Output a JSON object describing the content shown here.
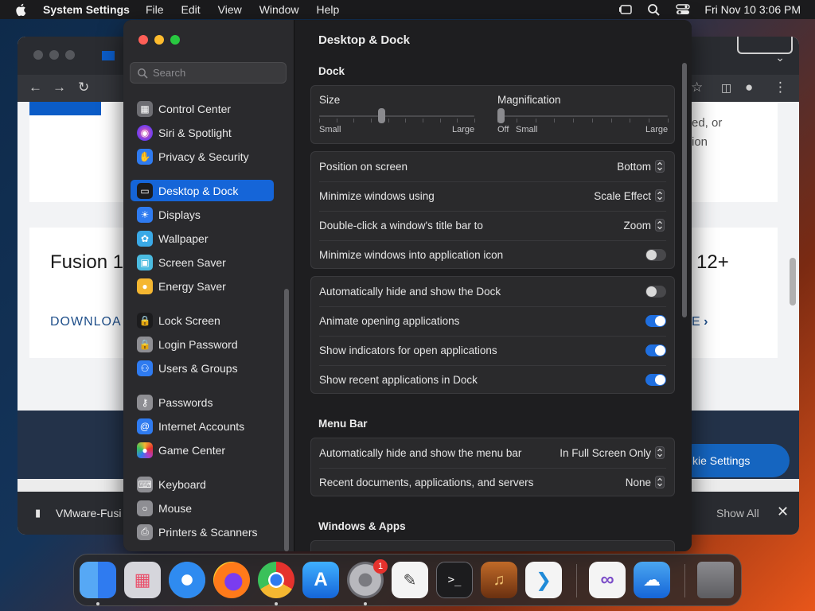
{
  "menubar": {
    "app_name": "System Settings",
    "menus": [
      "File",
      "Edit",
      "View",
      "Window",
      "Help"
    ],
    "datetime": "Fri Nov 10  3:06 PM"
  },
  "browser": {
    "partial_text_1": "ed, or",
    "partial_text_2": "ion",
    "product_left": "Fusion 1",
    "product_right": "12+",
    "download_left": "DOWNLOA",
    "download_right": "E",
    "cookie_button": "kie Settings",
    "download_file": "VMware-Fusi",
    "show_all": "Show All"
  },
  "sidebar": {
    "search_placeholder": "Search",
    "items": [
      {
        "label": "Control Center",
        "icon": "control-center-icon",
        "color": "#6e6e73"
      },
      {
        "label": "Siri & Spotlight",
        "icon": "siri-icon",
        "color": "#b03cc8"
      },
      {
        "label": "Privacy & Security",
        "icon": "privacy-hand-icon",
        "color": "#2f7bf0"
      },
      {
        "label": "Desktop & Dock",
        "icon": "desktop-dock-icon",
        "color": "#1c1c1e",
        "active": true
      },
      {
        "label": "Displays",
        "icon": "displays-icon",
        "color": "#2f7bf0"
      },
      {
        "label": "Wallpaper",
        "icon": "wallpaper-icon",
        "color": "#3aa9e6"
      },
      {
        "label": "Screen Saver",
        "icon": "screen-saver-icon",
        "color": "#4bbbe0"
      },
      {
        "label": "Energy Saver",
        "icon": "energy-saver-icon",
        "color": "#f5b731"
      },
      {
        "label": "Lock Screen",
        "icon": "lock-screen-icon",
        "color": "#1c1c1e"
      },
      {
        "label": "Login Password",
        "icon": "login-password-icon",
        "color": "#8e8e93"
      },
      {
        "label": "Users & Groups",
        "icon": "users-groups-icon",
        "color": "#2f7bf0"
      },
      {
        "label": "Passwords",
        "icon": "passwords-icon",
        "color": "#8e8e93"
      },
      {
        "label": "Internet Accounts",
        "icon": "internet-accounts-icon",
        "color": "#2f7bf0"
      },
      {
        "label": "Game Center",
        "icon": "game-center-icon",
        "color": "#ffffff"
      },
      {
        "label": "Keyboard",
        "icon": "keyboard-icon",
        "color": "#8e8e93"
      },
      {
        "label": "Mouse",
        "icon": "mouse-icon",
        "color": "#8e8e93"
      },
      {
        "label": "Printers & Scanners",
        "icon": "printers-scanners-icon",
        "color": "#8e8e93"
      }
    ]
  },
  "content": {
    "title": "Desktop & Dock",
    "dock_section": "Dock",
    "size_label": "Size",
    "size_min": "Small",
    "size_max": "Large",
    "size_value": 0.4,
    "magnification_label": "Magnification",
    "mag_off": "Off",
    "mag_min": "Small",
    "mag_max": "Large",
    "magnification_value": 0.0,
    "settings_group1": [
      {
        "label": "Position on screen",
        "value": "Bottom"
      },
      {
        "label": "Minimize windows using",
        "value": "Scale Effect"
      },
      {
        "label": "Double-click a window's title bar to",
        "value": "Zoom"
      },
      {
        "label": "Minimize windows into application icon",
        "toggle": false
      }
    ],
    "settings_group2": [
      {
        "label": "Automatically hide and show the Dock",
        "toggle": false
      },
      {
        "label": "Animate opening applications",
        "toggle": true
      },
      {
        "label": "Show indicators for open applications",
        "toggle": true
      },
      {
        "label": "Show recent applications in Dock",
        "toggle": true
      }
    ],
    "menu_bar_section": "Menu Bar",
    "menu_bar_rows": [
      {
        "label": "Automatically hide and show the menu bar",
        "value": "In Full Screen Only"
      },
      {
        "label": "Recent documents, applications, and servers",
        "value": "None"
      }
    ],
    "windows_apps_section": "Windows & Apps"
  },
  "dock": {
    "apps": [
      {
        "name": "Finder",
        "icon": "finder-icon",
        "running": true
      },
      {
        "name": "Launchpad",
        "icon": "launchpad-icon",
        "running": false
      },
      {
        "name": "Safari",
        "icon": "safari-icon",
        "running": false
      },
      {
        "name": "Firefox",
        "icon": "firefox-icon",
        "running": false
      },
      {
        "name": "Chrome",
        "icon": "chrome-icon",
        "running": true
      },
      {
        "name": "App Store",
        "icon": "app-store-icon",
        "running": false
      },
      {
        "name": "System Settings",
        "icon": "system-settings-icon",
        "running": true,
        "badge": "1"
      },
      {
        "name": "TextEdit",
        "icon": "textedit-icon",
        "running": false
      },
      {
        "name": "Terminal",
        "icon": "terminal-icon",
        "running": false
      },
      {
        "name": "GarageBand",
        "icon": "garageband-icon",
        "running": false
      },
      {
        "name": "VS Code",
        "icon": "vscode-icon",
        "running": false
      },
      {
        "name": "Visual Studio",
        "icon": "visual-studio-icon",
        "running": false
      },
      {
        "name": "Weather",
        "icon": "weather-icon",
        "running": false
      },
      {
        "name": "Trash",
        "icon": "trash-icon",
        "running": false
      }
    ]
  }
}
